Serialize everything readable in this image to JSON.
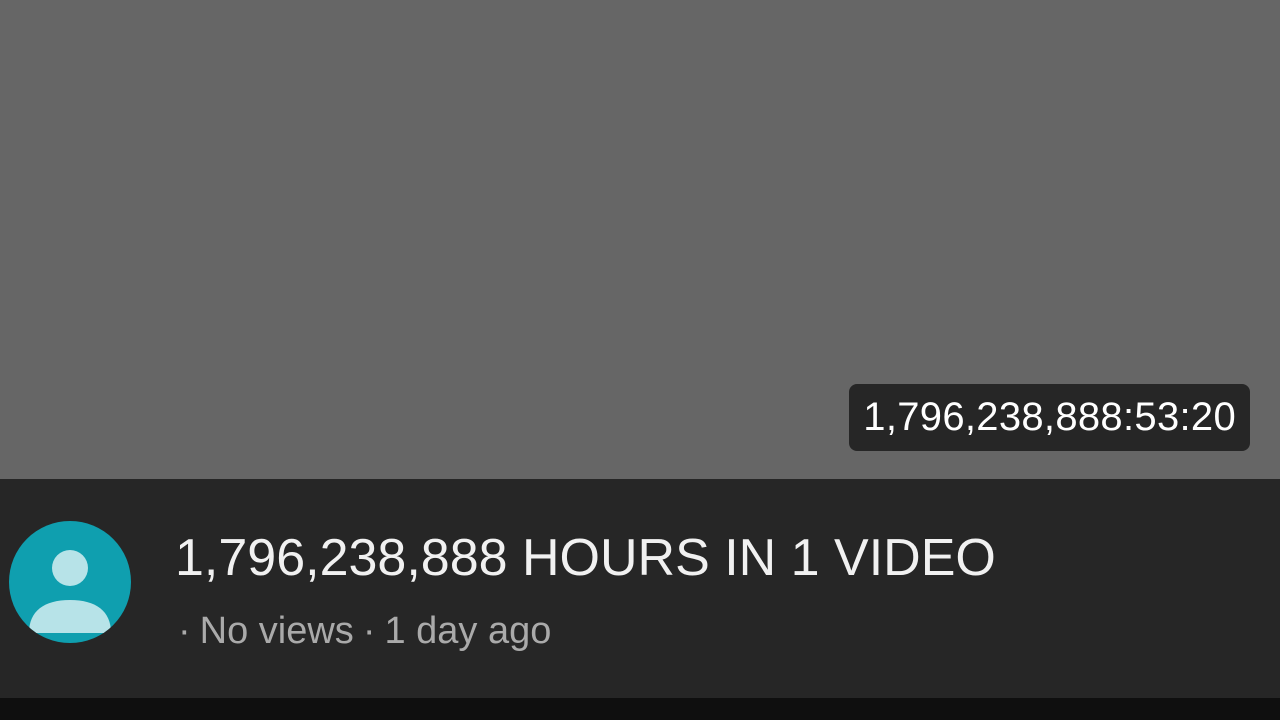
{
  "video": {
    "title": "1,796,238,888 HOURS IN 1 VIDEO",
    "duration": "1,796,238,888:53:20",
    "views": "No views",
    "uploaded": "1 day ago",
    "separator": "·"
  },
  "channel": {
    "avatar_icon": "default-person-icon",
    "avatar_color": "#0f9faf"
  },
  "colors": {
    "thumbnail_placeholder": "#666666",
    "panel_background": "#262626",
    "title_text": "#f1f1f1",
    "meta_text": "#aaaaaa"
  }
}
